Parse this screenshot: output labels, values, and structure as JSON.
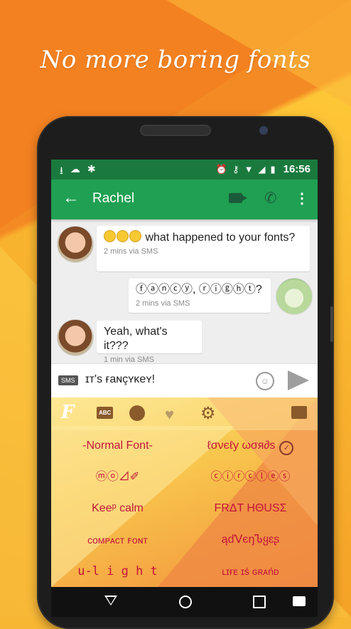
{
  "headline": "No more boring fonts",
  "colors": {
    "status_bar": "#1a7a3e",
    "toolbar": "#20a052",
    "font_text": "#c2143c"
  },
  "status_bar": {
    "left_icons": [
      "download-icon",
      "cloud-icon",
      "android-icon"
    ],
    "right_icons": [
      "alarm-icon",
      "key-icon",
      "wifi-icon",
      "signal-3g-icon",
      "battery-icon"
    ],
    "time": "16:56"
  },
  "toolbar": {
    "back_icon": "arrow-left-icon",
    "contact_name": "Rachel",
    "actions": [
      "video-call-icon",
      "phone-icon",
      "more-vert-icon"
    ]
  },
  "messages": [
    {
      "from": "Rachel",
      "text": "what happened to your fonts?",
      "meta": "2 mins via SMS"
    },
    {
      "from": "me",
      "text": "ⓕⓐⓝⓒⓨ, ⓡⓘⓖⓗⓣ?",
      "meta": "2 mins via SMS"
    },
    {
      "from": "Rachel",
      "text": "Yeah, what's it???",
      "meta": "1 min via SMS"
    }
  ],
  "compose": {
    "badge": "SMS",
    "text": "ɪт's ғaɴçʏκeʏ!",
    "emoji_button": "emoji-icon",
    "send_button": "send-icon"
  },
  "keyboard": {
    "tabs": [
      "fancy-f-logo",
      "ABC",
      "emoji-face-icon",
      "heart-icon",
      "settings-icon",
      "keyboard-icon"
    ],
    "abc_label": "ABC",
    "fonts": [
      {
        "label": "-Normal Font-",
        "selected": false
      },
      {
        "label": "ℓσνєℓу ωσя∂ѕ",
        "selected": true
      },
      {
        "label": "ⓜⓞ⊿✐",
        "selected": false
      },
      {
        "label": "ⓒⓘⓡⓒⓛⓔⓢ",
        "selected": false
      },
      {
        "label": "Keeᵖ calm",
        "selected": false
      },
      {
        "label": "FRΔT HΘUSΣ",
        "selected": false
      },
      {
        "label": "ᴄᴏᴍᴘᴀᴄᴛ ꜰᴏɴᴛ",
        "selected": false
      },
      {
        "label": "ąďᐯєŋᏖყɛʂ",
        "selected": false
      },
      {
        "label": "u-l i g h t",
        "selected": false
      },
      {
        "label": "ʟɪғᴇ ɪś ɢʀᴀńᴅ",
        "selected": false
      }
    ]
  },
  "nav_bar": [
    "back-icon",
    "home-icon",
    "recents-icon",
    "keyboard-switch-icon"
  ]
}
